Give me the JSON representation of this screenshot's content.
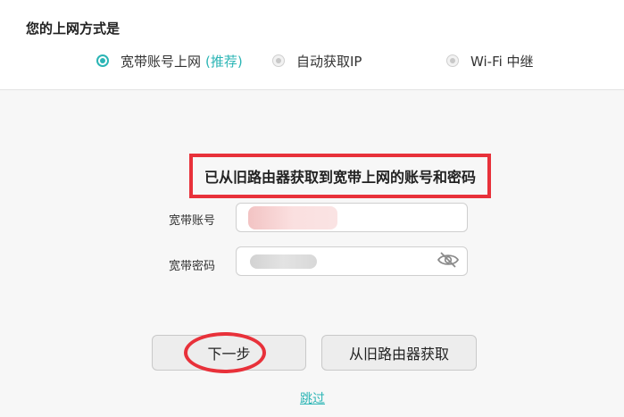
{
  "connection": {
    "title": "您的上网方式是",
    "options": [
      {
        "label": "宽带账号上网",
        "tag": "(推荐)",
        "selected": true
      },
      {
        "label": "自动获取IP",
        "selected": false
      },
      {
        "label": "Wi-Fi 中继",
        "selected": false
      }
    ]
  },
  "notice": "已从旧路由器获取到宽带上网的账号和密码",
  "form": {
    "account_label": "宽带账号",
    "password_label": "宽带密码"
  },
  "buttons": {
    "next": "下一步",
    "fetch_old": "从旧路由器获取"
  },
  "skip": "跳过",
  "colors": {
    "accent": "#2bb5b5",
    "annotation": "#e8313a"
  }
}
